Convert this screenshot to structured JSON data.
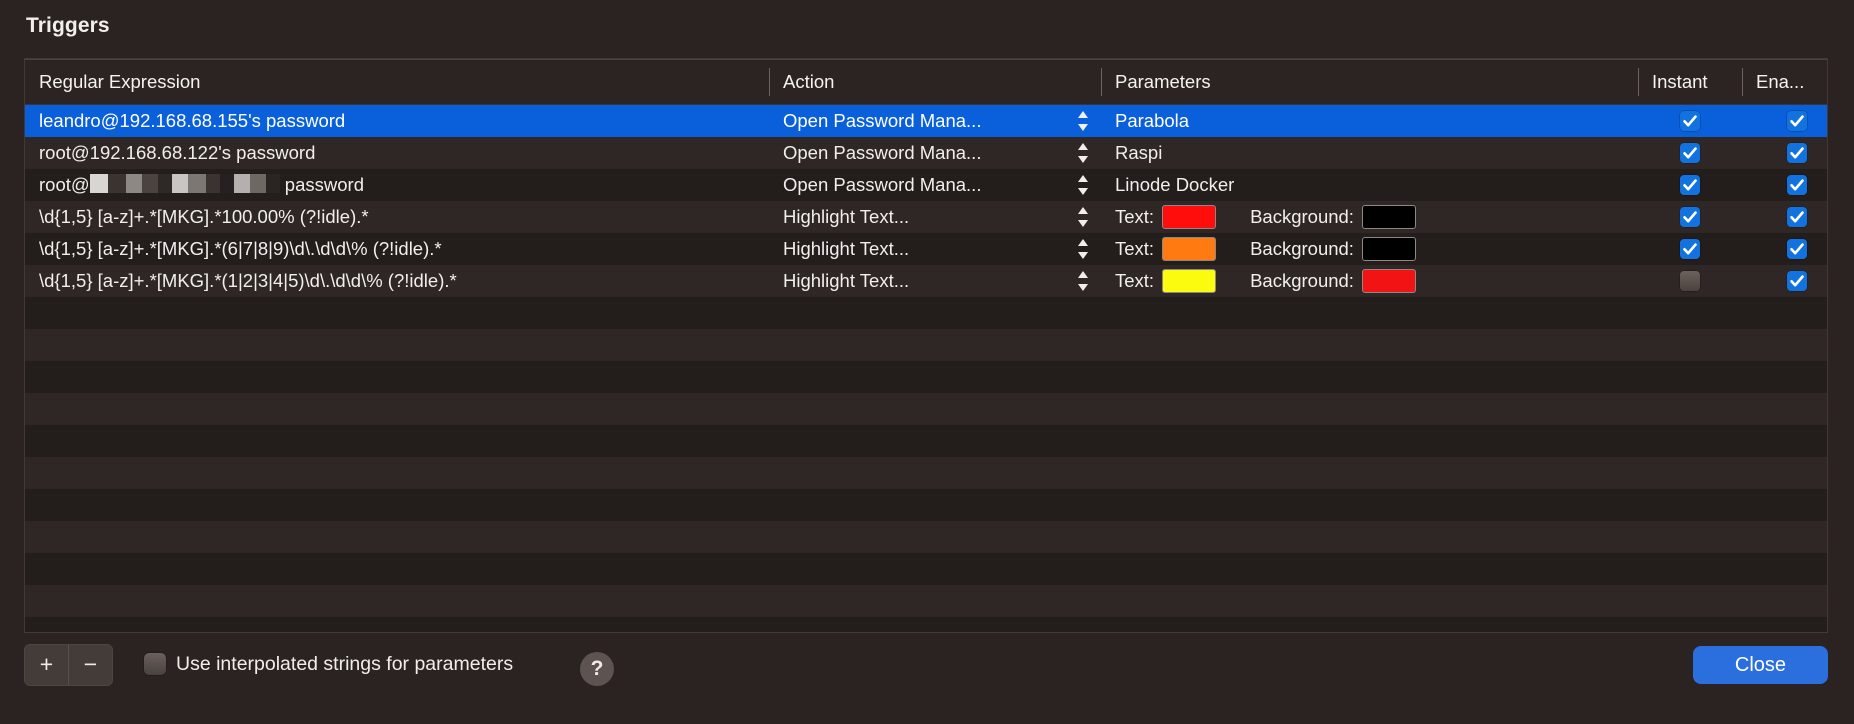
{
  "panel": {
    "title": "Triggers"
  },
  "table": {
    "columns": [
      {
        "key": "regex",
        "label": "Regular Expression"
      },
      {
        "key": "action",
        "label": "Action"
      },
      {
        "key": "params",
        "label": "Parameters"
      },
      {
        "key": "instant",
        "label": "Instant"
      },
      {
        "key": "enabled",
        "label": "Ena..."
      }
    ],
    "rows": [
      {
        "regex": "leandro@192.168.68.155's password",
        "redacted": false,
        "action": "Open Password Mana...",
        "param_type": "text",
        "param_value": "Parabola",
        "instant": true,
        "enabled": true,
        "selected": true,
        "has_stepper": true
      },
      {
        "regex": "root@192.168.68.122's password",
        "redacted": false,
        "action": "Open Password Mana...",
        "param_type": "text",
        "param_value": "Raspi",
        "instant": true,
        "enabled": true,
        "selected": false,
        "has_stepper": true
      },
      {
        "regex": "root@",
        "regex_suffix": " password",
        "redacted": true,
        "action": "Open Password Mana...",
        "param_type": "text",
        "param_value": "Linode Docker",
        "instant": true,
        "enabled": true,
        "selected": false,
        "has_stepper": true
      },
      {
        "regex": "\\d{1,5} [a-z]+.*[MKG].*100.00% (?!idle).*",
        "redacted": false,
        "action": "Highlight Text...",
        "param_type": "colors",
        "text_label": "Text:",
        "text_color": "#ff0d0d",
        "background_label": "Background:",
        "background_color": "#000000",
        "instant": true,
        "enabled": true,
        "selected": false,
        "has_stepper": true
      },
      {
        "regex": "\\d{1,5} [a-z]+.*[MKG].*(6|7|8|9)\\d\\.\\d\\d\\% (?!idle).*",
        "redacted": false,
        "action": "Highlight Text...",
        "param_type": "colors",
        "text_label": "Text:",
        "text_color": "#ff7a10",
        "background_label": "Background:",
        "background_color": "#000000",
        "instant": true,
        "enabled": true,
        "selected": false,
        "has_stepper": true
      },
      {
        "regex": "\\d{1,5} [a-z]+.*[MKG].*(1|2|3|4|5)\\d\\.\\d\\d\\% (?!idle).*",
        "redacted": false,
        "action": "Highlight Text...",
        "param_type": "colors",
        "text_label": "Text:",
        "text_color": "#fbfb10",
        "background_label": "Background:",
        "background_color": "#f21414",
        "instant": false,
        "enabled": true,
        "selected": false,
        "has_stepper": true
      }
    ],
    "empty_row_count": 10,
    "stepper_icon": "stepper-up-down-icon"
  },
  "bottom_bar": {
    "add_label": "+",
    "remove_label": "−",
    "interpolated_label": "Use interpolated strings for parameters",
    "interpolated_checked": false,
    "help_label": "?",
    "close_label": "Close"
  },
  "colors": {
    "accent": "#0a60da",
    "button_blue": "#2b6fdf",
    "checkbox_blue": "#1273e0",
    "panel_bg": "#2a2322",
    "row_odd": "#231d1c",
    "row_even": "#2e2725",
    "header_bg": "#2b2423"
  }
}
